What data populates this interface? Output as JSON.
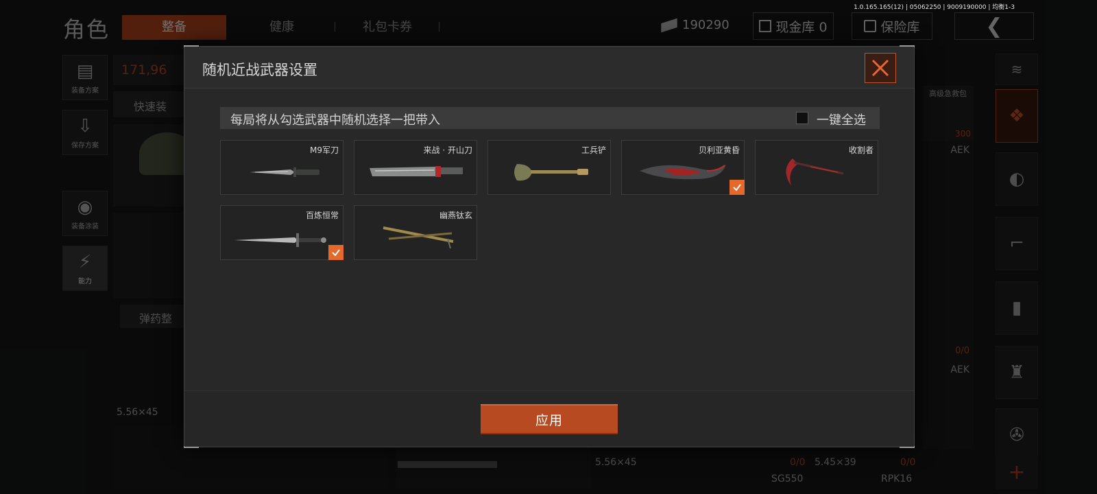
{
  "version_text": "1.0.165.165(12) | 05062250 | 9009190000 | 均衡1-3",
  "header": {
    "title": "角色",
    "tabs": [
      {
        "label": "整备",
        "active": true
      },
      {
        "label": "健康",
        "active": false
      },
      {
        "label": "礼包卡券",
        "active": false
      }
    ],
    "money": "190290",
    "cash_vault": "现金库 0",
    "insurance": "保险库"
  },
  "left_sidebar": [
    {
      "label": "装备方案",
      "icon": "backpack-icon"
    },
    {
      "label": "保存方案",
      "icon": "download-icon"
    },
    {
      "label": "装备涂装",
      "icon": "paint-icon"
    },
    {
      "label": "能力",
      "icon": "power-icon",
      "active": true
    }
  ],
  "loadout": {
    "weight": "171,96",
    "quick_equip": "快速装",
    "ammo_button": "弹药整",
    "caliber_left": "5.56×45"
  },
  "right_panel": {
    "medkit_label": "高级急救包",
    "medkit_count": "300",
    "guns": [
      {
        "name": "AEK",
        "count": "0/0"
      },
      {
        "name": "AEK",
        "count": ""
      }
    ],
    "bottom": [
      {
        "caliber": "5.56×45",
        "count": "0/0",
        "name": "SG550"
      },
      {
        "caliber": "5.45×39",
        "count": "0/0",
        "name": "RPK16"
      }
    ]
  },
  "modal": {
    "title": "随机近战武器设置",
    "instruction": "每局将从勾选武器中随机选择一把带入",
    "select_all_label": "一键全选",
    "select_all_checked": false,
    "apply_label": "应用",
    "accent_color": "#e4692b",
    "weapons": [
      {
        "name": "M9军刀",
        "checked": false,
        "icon": "combat-knife-icon"
      },
      {
        "name": "来战 · 开山刀",
        "checked": false,
        "icon": "machete-icon"
      },
      {
        "name": "工兵铲",
        "checked": false,
        "icon": "shovel-icon"
      },
      {
        "name": "贝利亚黄昏",
        "checked": true,
        "icon": "curved-blade-icon"
      },
      {
        "name": "收割者",
        "checked": false,
        "icon": "scythe-icon"
      },
      {
        "name": "百炼恒常",
        "checked": true,
        "icon": "sword-icon"
      },
      {
        "name": "幽燕钛玄",
        "checked": false,
        "icon": "twin-dagger-icon"
      }
    ]
  }
}
